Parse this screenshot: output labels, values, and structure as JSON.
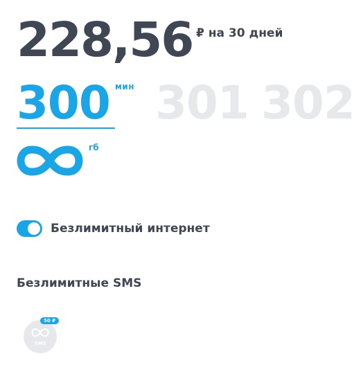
{
  "tariff": {
    "price": "228,56",
    "price_suffix": "₽ на 30 дней"
  },
  "minutes": {
    "options": [
      "300",
      "301",
      "302"
    ],
    "selected": "300",
    "unit": "мин"
  },
  "internet": {
    "unit": "гб",
    "icon": "infinity-icon"
  },
  "unlimited_internet": {
    "label": "Безлимитный интернет",
    "enabled": true
  },
  "sms": {
    "title": "Безлимитные SMS",
    "option_label": "SMS",
    "price_badge": "50 ₽",
    "icon": "infinity-icon"
  },
  "colors": {
    "accent": "#1aa5e6",
    "text": "#3f4654",
    "inactive": "#e6e8eb"
  }
}
